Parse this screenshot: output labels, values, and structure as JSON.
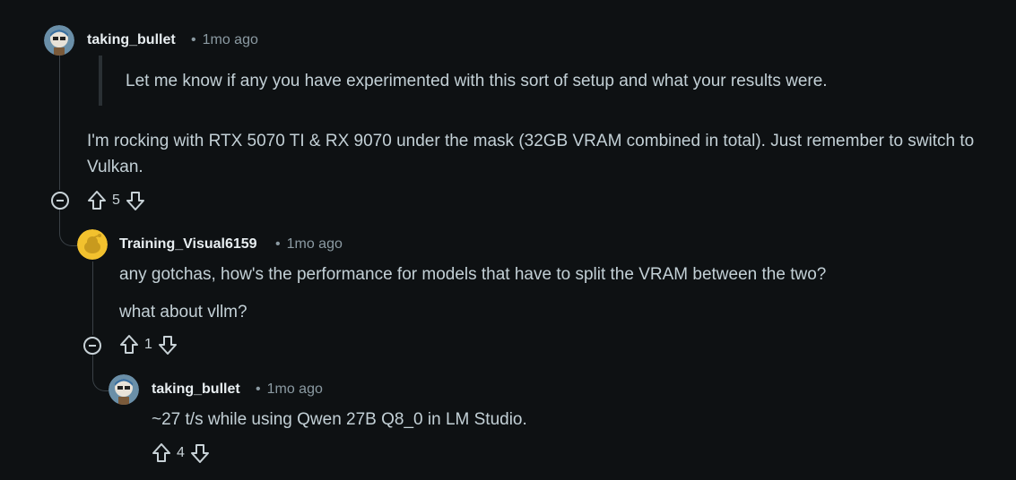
{
  "comments": [
    {
      "author": "taking_bullet",
      "time": "1mo ago",
      "quote": "Let me know if any you have experimented with this sort of setup and what your results were.",
      "body": "I'm rocking with RTX 5070 TI & RX 9070 under the mask (32GB VRAM combined in total). Just remember to switch to Vulkan.",
      "votes": "5"
    },
    {
      "author": "Training_Visual6159",
      "time": "1mo ago",
      "body_lines": [
        "any gotchas, how's the performance for models that have to split the VRAM between the two?",
        "what about vllm?"
      ],
      "votes": "1"
    },
    {
      "author": "taking_bullet",
      "time": "1mo ago",
      "body": "~27 t/s while using Qwen 27B Q8_0 in LM Studio.",
      "votes": "4"
    }
  ],
  "separator": "•",
  "colors": {
    "background": "#0e1113",
    "text": "#c3d0d6",
    "muted": "#8b9aa2",
    "thread_line": "#3a4146",
    "avatar_yellow": "#f2c12e"
  }
}
